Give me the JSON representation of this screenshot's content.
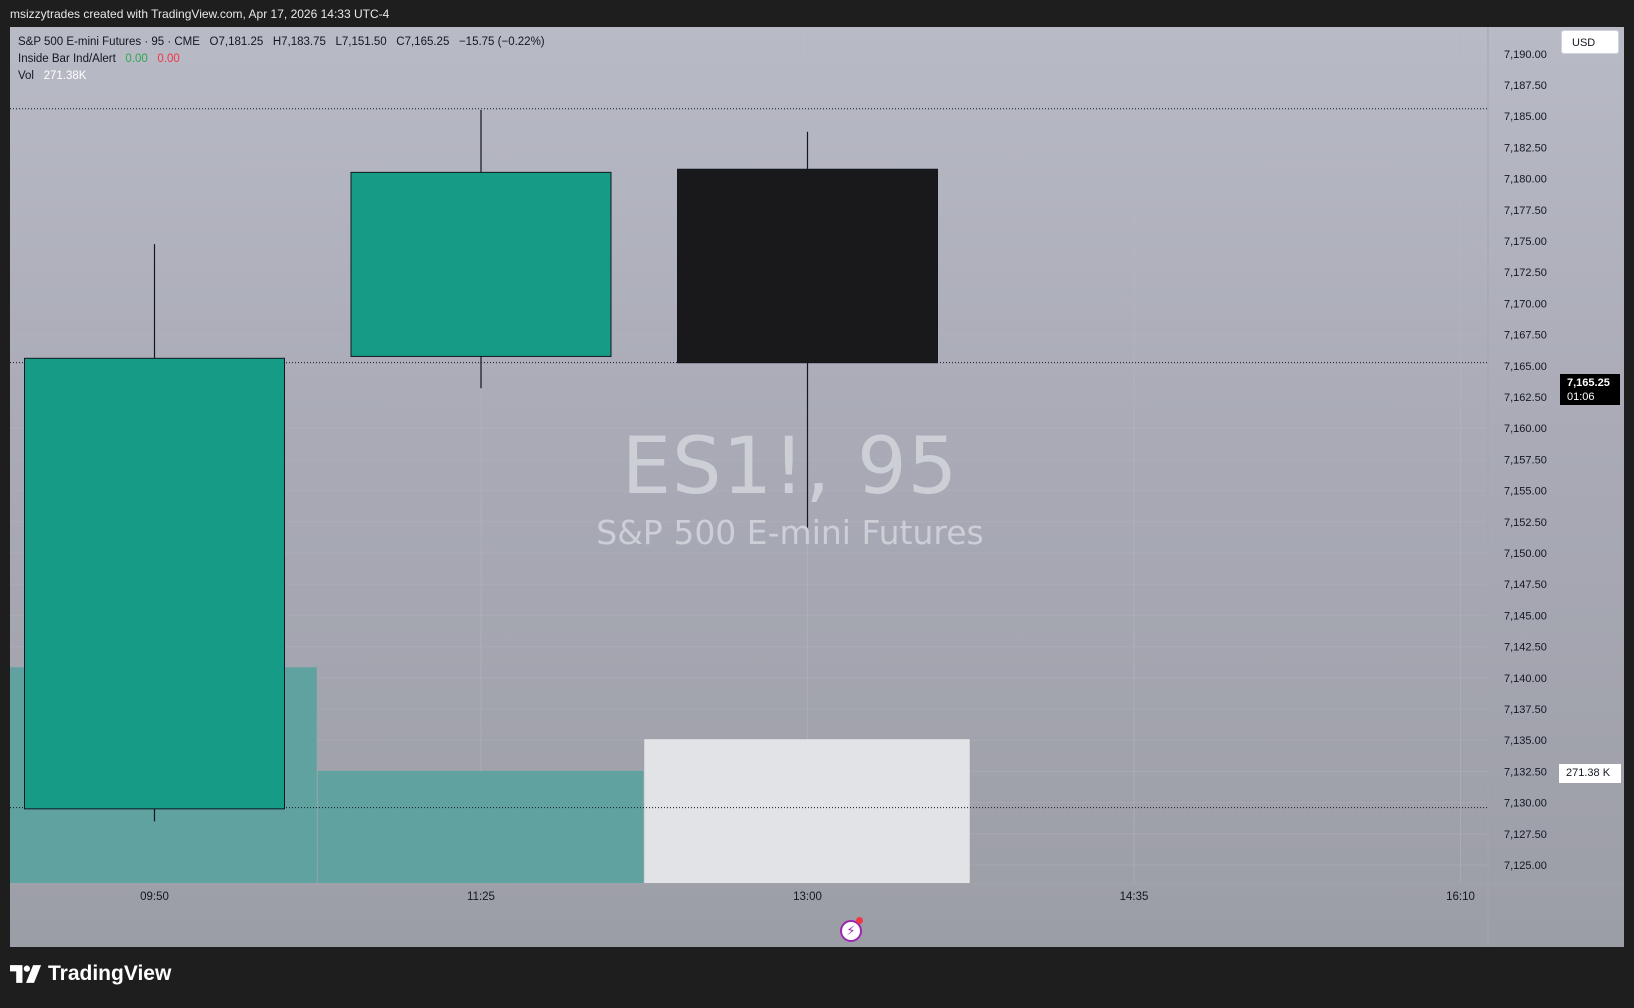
{
  "topbar": {
    "text": "msizzytrades created with TradingView.com, Apr 17, 2026 14:33 UTC-4"
  },
  "legend": {
    "title": "S&P 500 E-mini Futures · 95 · CME",
    "open": "O7,181.25",
    "high": "H7,183.75",
    "low": "L7,151.50",
    "close": "C7,165.25",
    "change": "−15.75 (−0.22%)",
    "indicator_name": "Inside Bar Ind/Alert",
    "indicator_v1": "0.00",
    "indicator_v2": "0.00",
    "vol_label": "Vol",
    "vol_value": "271.38K"
  },
  "currency": "USD",
  "price_tag": {
    "price": "7,165.25",
    "countdown": "01:06"
  },
  "vol_tag": "271.38 K",
  "watermark": {
    "symbol": "ES1!, 95",
    "description": "S&P 500 E-mini Futures"
  },
  "footer": {
    "brand": "TradingView"
  },
  "colors": {
    "up": "#169b86",
    "down": "#19191b",
    "vol_up": "#5fa29f",
    "vol_down": "#e2e3e6"
  },
  "chart_data": {
    "type": "candlestick",
    "symbol": "ES1!",
    "interval": "95",
    "ylim": [
      7123.5,
      7191.5
    ],
    "y_ticks": [
      "7,125.00",
      "7,127.50",
      "7,130.00",
      "7,132.50",
      "7,135.00",
      "7,137.50",
      "7,140.00",
      "7,142.50",
      "7,145.00",
      "7,147.50",
      "7,150.00",
      "7,152.50",
      "7,155.00",
      "7,157.50",
      "7,160.00",
      "7,162.50",
      "7,165.00",
      "7,167.50",
      "7,170.00",
      "7,172.50",
      "7,175.00",
      "7,177.50",
      "7,180.00",
      "7,182.50",
      "7,185.00",
      "7,187.50",
      "7,190.00"
    ],
    "x_ticks": [
      "09:50",
      "11:25",
      "13:00",
      "14:35",
      "16:10"
    ],
    "candles": [
      {
        "time": "09:50",
        "open": 7129.5,
        "high": 7174.75,
        "low": 7128.5,
        "close": 7165.6
      },
      {
        "time": "11:25",
        "open": 7165.75,
        "high": 7185.5,
        "low": 7163.2,
        "close": 7180.5
      },
      {
        "time": "13:00",
        "open": 7180.75,
        "high": 7183.75,
        "low": 7151.5,
        "close": 7165.25
      }
    ],
    "volume": [
      {
        "time": "09:50",
        "direction": "up"
      },
      {
        "time": "11:25",
        "direction": "up"
      },
      {
        "time": "13:00",
        "direction": "down",
        "value": "271.38K"
      }
    ],
    "horizontal_lines": [
      7185.6,
      7165.25,
      7129.6
    ],
    "grid": true
  }
}
